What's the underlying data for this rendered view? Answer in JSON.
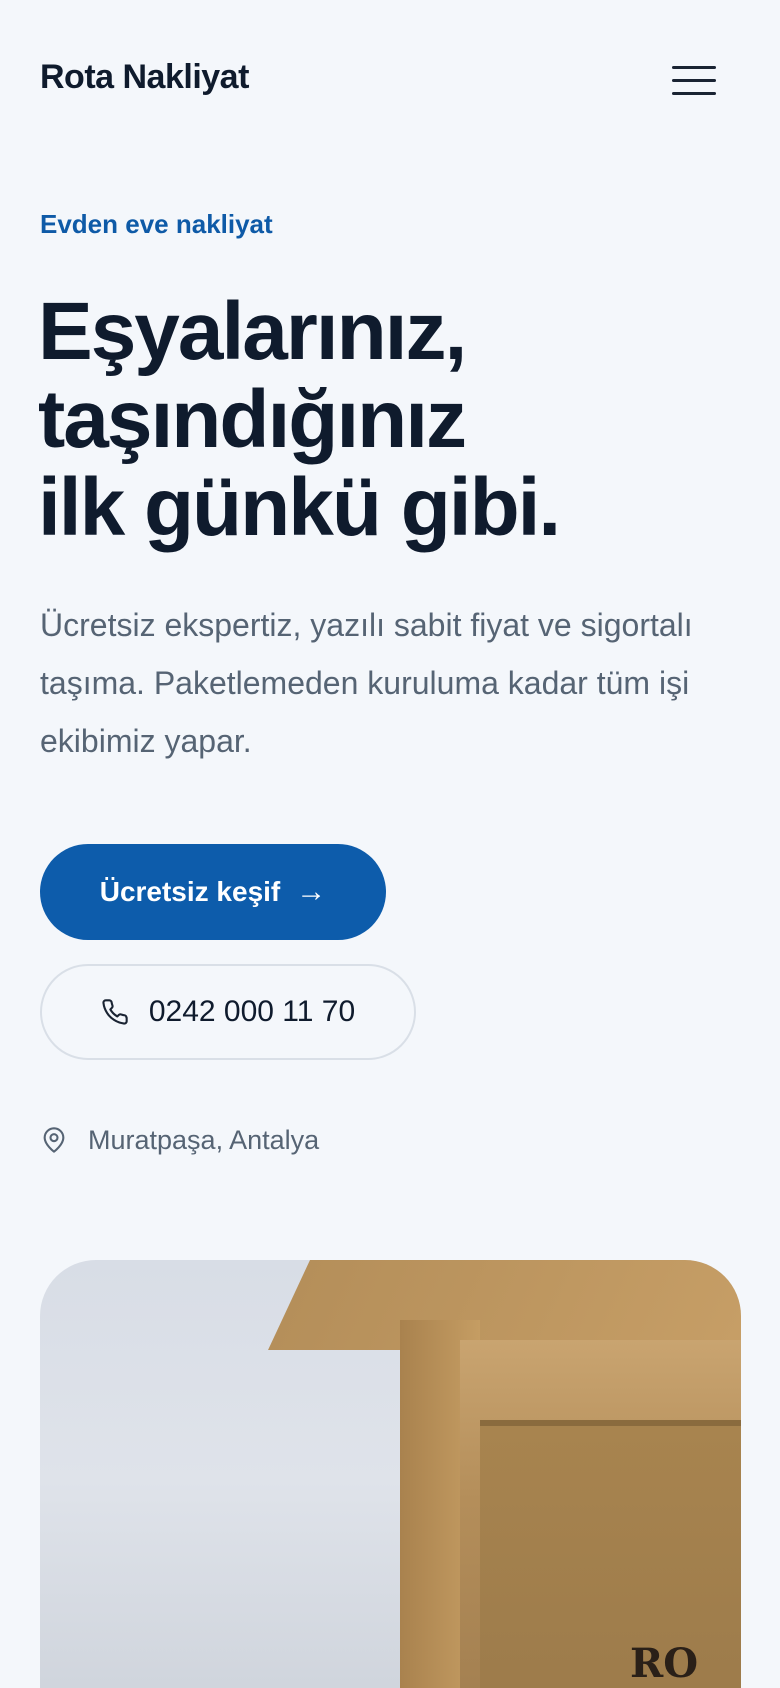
{
  "header": {
    "brand": "Rota Nakliyat",
    "menu_icon": "hamburger-icon"
  },
  "hero": {
    "eyebrow": "Evden eve nakliyat",
    "headline_lines": [
      "Eşyalarınız,",
      "taşındığınız",
      "ilk günkü gibi."
    ],
    "lead": "Ücretsiz ekspertiz, yazılı sabit fiyat ve sigortalı taşıma. Paketlemeden kuruluma kadar tüm işi ekibimiz yapar.",
    "cta_primary": {
      "label": "Ücretsiz keşif",
      "icon": "arrow-right-icon"
    },
    "cta_phone": {
      "label": "0242 000 11 70",
      "icon": "phone-icon"
    },
    "location": {
      "label": "Muratpaşa, Antalya",
      "icon": "map-pin-icon"
    }
  },
  "image": {
    "stamp_text": "RO"
  },
  "colors": {
    "accent": "#0d5cab",
    "eyebrow": "#0e5aa7",
    "text": "#0f1b2d",
    "muted": "#566474",
    "background": "#f4f7fb"
  }
}
